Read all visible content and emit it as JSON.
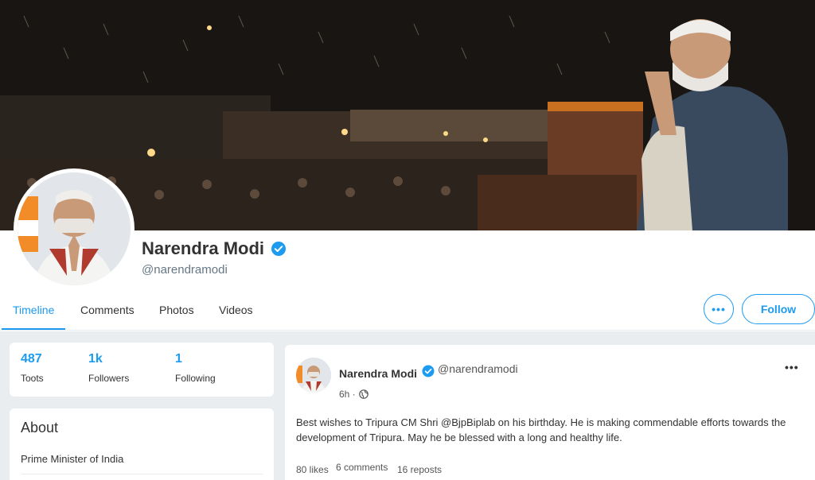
{
  "profile": {
    "name": "Narendra Modi",
    "handle": "@narendramodi"
  },
  "tabs": [
    {
      "label": "Timeline",
      "active": true
    },
    {
      "label": "Comments",
      "active": false
    },
    {
      "label": "Photos",
      "active": false
    },
    {
      "label": "Videos",
      "active": false
    }
  ],
  "actions": {
    "more_label": "•••",
    "follow_label": "Follow"
  },
  "stats": [
    {
      "value": "487",
      "label": "Toots"
    },
    {
      "value": "1k",
      "label": "Followers"
    },
    {
      "value": "1",
      "label": "Following"
    }
  ],
  "about": {
    "title": "About",
    "bio": "Prime Minister of India"
  },
  "post": {
    "author": "Narendra Modi",
    "handle": "@narendramodi",
    "time": "6h ·",
    "visibility_icon": "globe-icon",
    "menu_label": "•••",
    "text": "Best wishes to Tripura CM Shri @BjpBiplab on his birthday. He is making commendable efforts towards the development of Tripura. May he be blessed with a long and healthy life.",
    "likes": "80 likes",
    "comments": "6 comments",
    "reposts": "16 reposts"
  },
  "colors": {
    "accent": "#1d9bf0",
    "background": "#e9edf0",
    "verified": "#1d9bf0"
  }
}
